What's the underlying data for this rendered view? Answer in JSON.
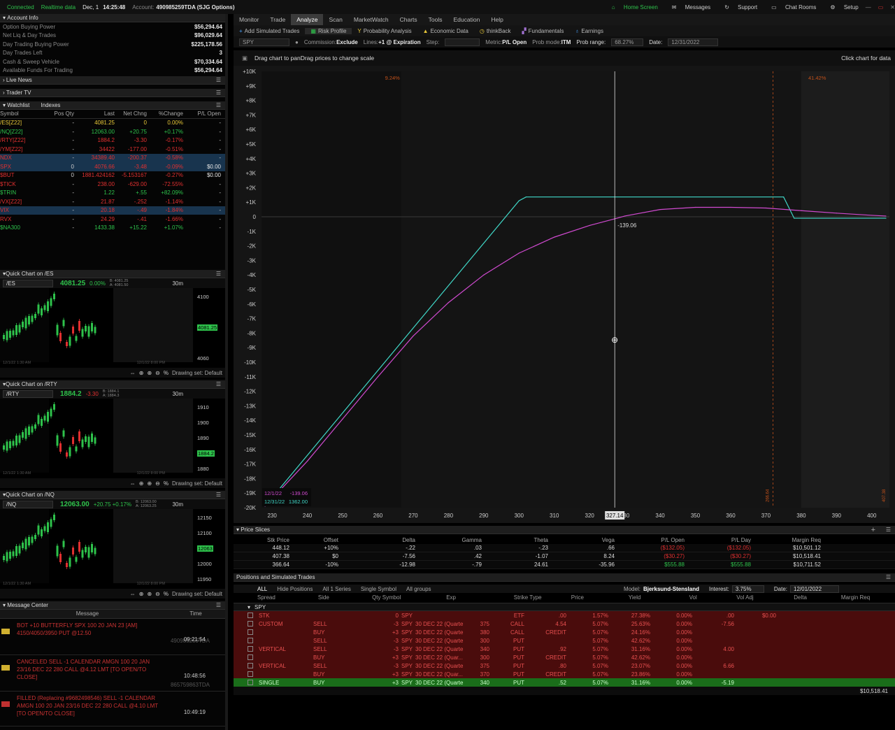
{
  "topbar": {
    "connected": "Connected",
    "realtime": "Realtime data",
    "date": "Dec, 1",
    "time": "14:25:48",
    "account_label": "Account:",
    "account": "490985259TDA (SJG Options)",
    "home": "Home Screen",
    "messages": "Messages",
    "support": "Support",
    "chat": "Chat Rooms",
    "setup": "Setup",
    "ondemand": "OnDemand"
  },
  "account_info": {
    "title": "Account Info",
    "rows": [
      [
        "Option Buying Power",
        "$56,294.64"
      ],
      [
        "Net Liq & Day Trades",
        "$96,029.64"
      ],
      [
        "Day Trading Buying Power",
        "$225,178.56"
      ],
      [
        "Day Trades Left",
        "3"
      ],
      [
        "Cash & Sweep Vehicle",
        "$70,334.64"
      ],
      [
        "Available Funds For Trading",
        "$56,294.64"
      ]
    ]
  },
  "panels": {
    "live_news": "Live News",
    "trader_tv": "Trader TV",
    "watchlist": "Watchlist",
    "indexes": "Indexes"
  },
  "watchlist": {
    "headers": [
      "Symbol",
      "Pos Qty",
      "Last",
      "Net Chng",
      "%Change",
      "P/L Open"
    ],
    "rows": [
      {
        "c": "y",
        "s": "/ES[Z22]",
        "q": "-",
        "l": "4081.25",
        "n": "0",
        "p": "0.00%",
        "o": "-"
      },
      {
        "c": "g",
        "s": "/NQ[Z22]",
        "q": "-",
        "l": "12063.00",
        "n": "+20.75",
        "p": "+0.17%",
        "o": "-"
      },
      {
        "c": "r",
        "s": "/RTY[Z22]",
        "q": "-",
        "l": "1884.2",
        "n": "-3.30",
        "p": "-0.17%",
        "o": "-"
      },
      {
        "c": "r",
        "s": "/YM[Z22]",
        "q": "-",
        "l": "34422",
        "n": "-177.00",
        "p": "-0.51%",
        "o": "-"
      },
      {
        "c": "r",
        "s": "NDX",
        "q": "-",
        "l": "34389.40",
        "n": "-200.37",
        "p": "-0.58%",
        "o": "-",
        "sel": true
      },
      {
        "c": "r",
        "s": "SPX",
        "q": "0",
        "l": "4076.66",
        "n": "-3.48",
        "p": "-0.09%",
        "o": "$0.00",
        "sel": true
      },
      {
        "c": "r",
        "s": "$BUT",
        "q": "0",
        "l": "1881.424162",
        "n": "-5.153167",
        "p": "-0.27%",
        "o": "$0.00"
      },
      {
        "c": "r",
        "s": "$TICK",
        "q": "-",
        "l": "238.00",
        "n": "-629.00",
        "p": "-72.55%",
        "o": "-"
      },
      {
        "c": "g",
        "s": "$TRIN",
        "q": "-",
        "l": "1.22",
        "n": "+.55",
        "p": "+82.09%",
        "o": "-"
      },
      {
        "c": "r",
        "s": "/VX[Z22]",
        "q": "-",
        "l": "21.87",
        "n": "-.252",
        "p": "-1.14%",
        "o": "-"
      },
      {
        "c": "r",
        "s": "VIX",
        "q": "-",
        "l": "20.18",
        "n": "-.49",
        "p": "-1.84%",
        "o": "-",
        "sel": true
      },
      {
        "c": "r",
        "s": "RVX",
        "q": "-",
        "l": "24.29",
        "n": "-.41",
        "p": "-1.66%",
        "o": "-"
      },
      {
        "c": "g",
        "s": "$NA300",
        "q": "-",
        "l": "1433.38",
        "n": "+15.22",
        "p": "+1.07%",
        "o": "-"
      }
    ]
  },
  "quick": [
    {
      "title": "Quick Chart on /ES",
      "sym": "/ES",
      "price": "4081.25",
      "chg": "0.00%",
      "bid": "B: 4081.25",
      "ask": "A: 4081.50",
      "tf": "30m",
      "axis": [
        "4100",
        "4081.25",
        "4060"
      ],
      "dates": [
        "12/1/22 1:30 AM",
        "12/1/22 8:00 PM"
      ],
      "drawing": "Drawing set: Default"
    },
    {
      "title": "Quick Chart on /RTY",
      "sym": "/RTY",
      "price": "1884.2",
      "chg": "-3.30",
      "bid": "B: 1884.1",
      "ask": "A: 1884.3",
      "tf": "30m",
      "axis": [
        "1910",
        "1900",
        "1890",
        "1884.2",
        "1880"
      ],
      "dates": [
        "12/1/22 1:30 AM",
        "12/1/22 8:00 PM"
      ],
      "drawing": "Drawing set: Default"
    },
    {
      "title": "Quick Chart on /NQ",
      "sym": "/NQ",
      "price": "12063.00",
      "chg": "+20.75 +0.17%",
      "bid": "B: 12063.00",
      "ask": "A: 12063.25",
      "tf": "30m",
      "axis": [
        "12150",
        "12100",
        "12063",
        "12000",
        "11950"
      ],
      "dates": [
        "12/1/22 1:30 AM",
        "12/1/22 8:00 PM"
      ],
      "drawing": "Drawing set: Default"
    }
  ],
  "messages": {
    "title": "Message Center",
    "col_msg": "Message",
    "col_time": "Time",
    "items": [
      {
        "text": "BOT +10 BUTTERFLY SPX 100 20 JAN 23 [AM] 4150/4050/3950 PUT @12.50",
        "acct": "490985259TDA",
        "time": "09:21:54"
      },
      {
        "text": "CANCELED SELL -1 CALENDAR AMGN 100 20 JAN 23/16 DEC 22 280 CALL @4.12 LMT [TO OPEN/TO CLOSE]",
        "acct": "865759863TDA",
        "time": "10:48:56"
      },
      {
        "text": "FILLED (Replacing #9682498546) SELL -1 CALENDAR AMGN 100 20 JAN 23/16 DEC 22 280 CALL @4.10 LMT [TO OPEN/TO CLOSE]",
        "acct": "",
        "time": "10:49:19"
      }
    ]
  },
  "nav": [
    "Monitor",
    "Trade",
    "Analyze",
    "Scan",
    "MarketWatch",
    "Charts",
    "Tools",
    "Education",
    "Help"
  ],
  "subnav": [
    "Add Simulated Trades",
    "Risk Profile",
    "Probability Analysis",
    "Economic Data",
    "thinkBack",
    "Fundamentals",
    "Earnings"
  ],
  "toolbar": {
    "symbol": "SPY",
    "commission_label": "Commission:",
    "commission": "Exclude",
    "lines_label": "Lines:",
    "lines": "+1 @ Expiration",
    "step_label": "Step:",
    "metric_label": "Metric:",
    "metric": "P/L Open",
    "probmode_label": "Prob mode:",
    "probmode": "ITM",
    "probrange_label": "Prob range:",
    "probrange": "68.27%",
    "date_label": "Date:",
    "date": "12/31/2022"
  },
  "chart_header": {
    "hint": "Drag chart to panDrag prices to change scale",
    "right": "Click chart for data"
  },
  "chart_data": {
    "type": "line",
    "x_ticks": [
      230,
      240,
      250,
      260,
      270,
      280,
      290,
      300,
      310,
      320,
      330,
      340,
      350,
      360,
      370,
      380,
      390,
      400
    ],
    "y_ticks": [
      "+10K",
      "+9K",
      "+8K",
      "+7K",
      "+6K",
      "+5K",
      "+4K",
      "+3K",
      "+2K",
      "+1K",
      "0",
      "-1K",
      "-2K",
      "-3K",
      "-4K",
      "-5K",
      "-6K",
      "-7K",
      "-8K",
      "-9K",
      "-10K",
      "-11K",
      "-12K",
      "-13K",
      "-14K",
      "-15K",
      "-16K",
      "-17K",
      "-18K",
      "-19K",
      "-20K"
    ],
    "xlim": [
      227,
      405
    ],
    "ylim": [
      -20000,
      10000
    ],
    "series": [
      {
        "name": "12/31/22",
        "color": "#40d8c8",
        "x": [
          228,
          300,
          302,
          375,
          378,
          404
        ],
        "y": [
          -19900,
          1100,
          1362,
          1362,
          -100,
          -100
        ]
      },
      {
        "name": "12/1/22",
        "color": "#d04ad0",
        "x": [
          228,
          240,
          250,
          260,
          270,
          280,
          290,
          300,
          310,
          320,
          327.14,
          330,
          340,
          350,
          360,
          370,
          380,
          390,
          400,
          404
        ],
        "y": [
          -19900,
          -16800,
          -13900,
          -11000,
          -8200,
          -5900,
          -4000,
          -2500,
          -1400,
          -600,
          -139.06,
          50,
          500,
          650,
          650,
          600,
          420,
          250,
          100,
          50
        ]
      }
    ],
    "cursor_x": 327.14,
    "cursor_label": "327.14",
    "cursor_value": "-139.06",
    "prob_left": "9.24%",
    "prob_right": "41.42%",
    "vline_left_label": "266.64",
    "vline_right_label": "407.38",
    "legend": [
      {
        "date": "12/1/22",
        "value": "-139.06"
      },
      {
        "date": "12/31/22",
        "value": "1362.00"
      }
    ]
  },
  "price_slices": {
    "title": "Price Slices",
    "headers": [
      "Stk Price",
      "Offset",
      "Delta",
      "Gamma",
      "Theta",
      "Vega",
      "P/L Open",
      "P/L Day",
      "Margin Req"
    ],
    "rows": [
      [
        "448.12",
        "+10%",
        "-.22",
        ".03",
        "-.23",
        ".66",
        "($132.05)",
        "($132.05)",
        "$10,501.12"
      ],
      [
        "407.38",
        "$0",
        "-7.56",
        ".42",
        "-1.07",
        "8.24",
        "($30.27)",
        "($30.27)",
        "$10,518.41"
      ],
      [
        "366.64",
        "-10%",
        "-12.98",
        "-.79",
        "24.61",
        "-35.96",
        "$555.88",
        "$555.88",
        "$10,711.52"
      ]
    ]
  },
  "positions": {
    "title": "Positions and Simulated Trades",
    "filters": [
      "ALL",
      "Hide Positions",
      "All 1 Series",
      "Single Symbol",
      "All groups"
    ],
    "model_label": "Model:",
    "model": "Bjerksund-Stensland",
    "interest_label": "Interest:",
    "interest": "3.75%",
    "date_label": "Date:",
    "date": "12/01/2022",
    "headers": [
      "Spread",
      "Side",
      "Qty Symbol",
      "Exp",
      "Strike Type",
      "Price",
      "Yield",
      "Vol",
      "Vol Adj",
      "Delta",
      "Margin Req"
    ],
    "group": "SPY",
    "rows": [
      {
        "cls": "red",
        "spread": "STK",
        "side": "",
        "qty": "0",
        "sym": "SPY",
        "exp": "",
        "strike": "",
        "type": "ETF",
        "price": ".00",
        "yield": "1.57%",
        "vol": "27.38%",
        "voladj": "0.00%",
        "delta": ".00",
        "margin": "$0.00"
      },
      {
        "cls": "red",
        "spread": "CUSTOM",
        "side": "SELL",
        "qty": "-3",
        "sym": "SPY",
        "exp": "30 DEC 22 (Quarte",
        "strike": "375",
        "type": "CALL",
        "price": "4.54",
        "yield": "5.07%",
        "vol": "25.63%",
        "voladj": "0.00%",
        "delta": "-7.56",
        "margin": ""
      },
      {
        "cls": "red",
        "spread": "",
        "side": "BUY",
        "qty": "+3",
        "sym": "SPY",
        "exp": "30 DEC 22 (Quarte",
        "strike": "380",
        "type": "CALL",
        "price": "CREDIT",
        "yield": "5.07%",
        "vol": "24.16%",
        "voladj": "0.00%",
        "delta": "",
        "margin": ""
      },
      {
        "cls": "red",
        "spread": "",
        "side": "SELL",
        "qty": "-3",
        "sym": "SPY",
        "exp": "30 DEC 22 (Quarte",
        "strike": "300",
        "type": "PUT",
        "price": "",
        "yield": "5.07%",
        "vol": "42.62%",
        "voladj": "0.00%",
        "delta": "",
        "margin": ""
      },
      {
        "cls": "red",
        "spread": "VERTICAL",
        "side": "SELL",
        "qty": "-3",
        "sym": "SPY",
        "exp": "30 DEC 22 (Quarte",
        "strike": "340",
        "type": "PUT",
        "price": ".92",
        "yield": "5.07%",
        "vol": "31.16%",
        "voladj": "0.00%",
        "delta": "4.00",
        "margin": ""
      },
      {
        "cls": "red",
        "spread": "",
        "side": "BUY",
        "qty": "+3",
        "sym": "SPY",
        "exp": "30 DEC 22 (Quar...",
        "strike": "300",
        "type": "PUT",
        "price": "CREDIT",
        "yield": "5.07%",
        "vol": "42.62%",
        "voladj": "0.00%",
        "delta": "",
        "margin": ""
      },
      {
        "cls": "red",
        "spread": "VERTICAL",
        "side": "SELL",
        "qty": "-3",
        "sym": "SPY",
        "exp": "30 DEC 22 (Quarte",
        "strike": "375",
        "type": "PUT",
        "price": ".80",
        "yield": "5.07%",
        "vol": "23.07%",
        "voladj": "0.00%",
        "delta": "6.66",
        "margin": ""
      },
      {
        "cls": "red",
        "spread": "",
        "side": "BUY",
        "qty": "+3",
        "sym": "SPY",
        "exp": "30 DEC 22 (Quar...",
        "strike": "370",
        "type": "PUT",
        "price": "CREDIT",
        "yield": "5.07%",
        "vol": "23.86%",
        "voladj": "0.00%",
        "delta": "",
        "margin": ""
      },
      {
        "cls": "grn",
        "spread": "SINGLE",
        "side": "BUY",
        "qty": "+3",
        "sym": "SPY",
        "exp": "30 DEC 22 (Quarte",
        "strike": "340",
        "type": "PUT",
        "price": ".52",
        "yield": "5.07%",
        "vol": "31.16%",
        "voladj": "0.00%",
        "delta": "-5.19",
        "margin": ""
      }
    ],
    "total": "$10,518.41"
  }
}
